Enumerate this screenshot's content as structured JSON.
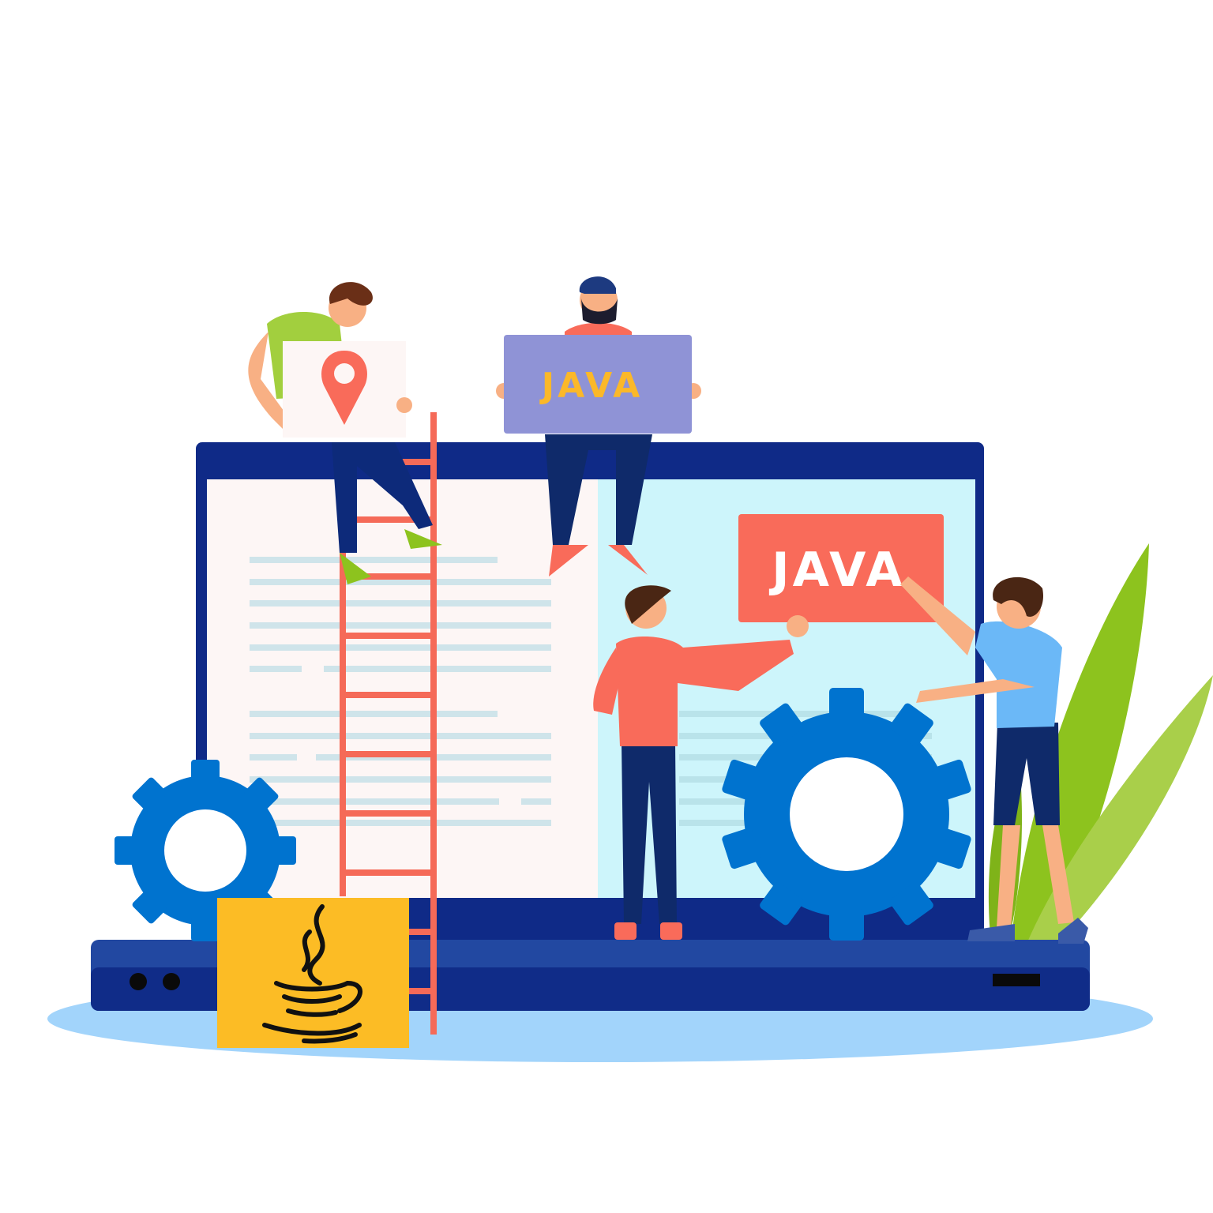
{
  "signs": {
    "held_sign_label": "JAVA",
    "screen_sign_label": "JAVA"
  },
  "colors": {
    "laptop_frame": "#0f2a87",
    "laptop_base": "#2248a1",
    "screen_left": "#fdf6f5",
    "screen_right": "#cdf5fb",
    "gear_blue": "#0073cf",
    "ladder_red": "#f56a58",
    "held_sign_purple": "#8f93d6",
    "held_sign_text": "#fbb829",
    "screen_sign_red": "#f96b5a",
    "java_logo_tile": "#fcbc25",
    "leaf_green": "#8dc31e",
    "shadow_blue": "#a2d4fb"
  },
  "icons": {
    "map_pin": "location-pin-icon",
    "java_logo": "java-coffee-cup-icon",
    "gear": "gear-icon"
  }
}
